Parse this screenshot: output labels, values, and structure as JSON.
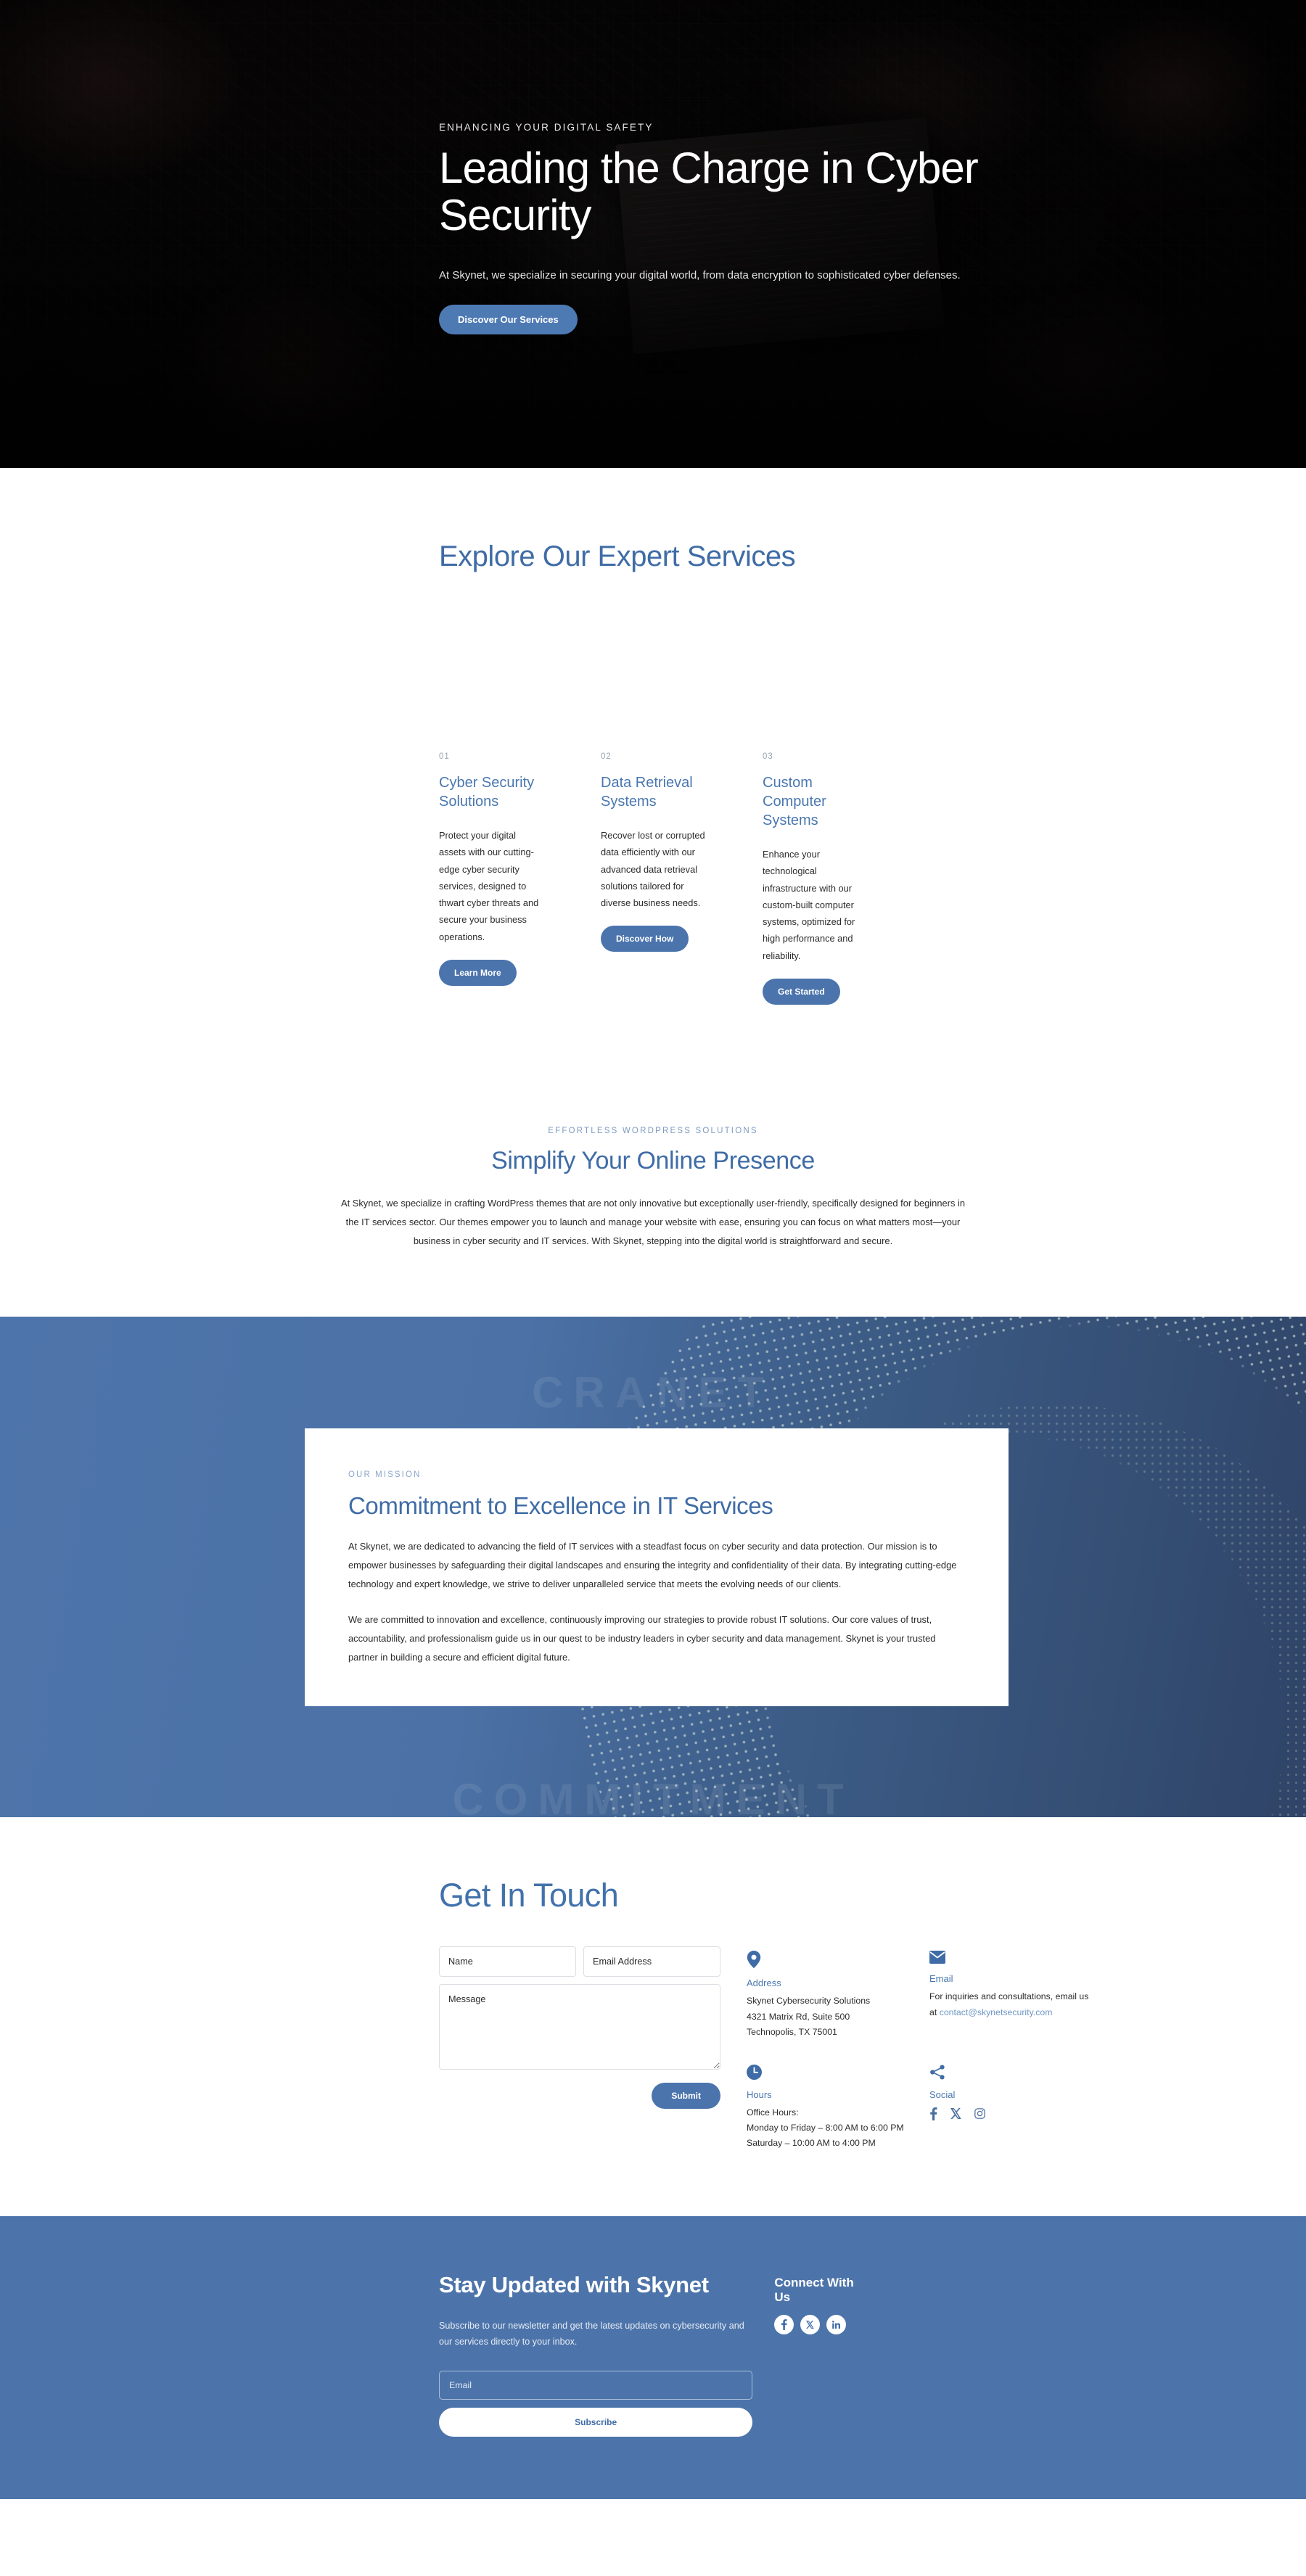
{
  "hero": {
    "eyebrow": "ENHANCING YOUR DIGITAL SAFETY",
    "title": "Leading the Charge in Cyber Security",
    "subtitle": "At Skynet, we specialize in securing your digital world, from data encryption to sophisticated cyber defenses.",
    "cta": "Discover Our Services"
  },
  "services": {
    "title": "Explore Our Expert Services",
    "cards": [
      {
        "num": "01",
        "title": "Cyber Security Solutions",
        "text": "Protect your digital assets with our cutting-edge cyber security services, designed to thwart cyber threats and secure your business operations.",
        "cta": "Learn More"
      },
      {
        "num": "02",
        "title": "Data Retrieval Systems",
        "text": "Recover lost or corrupted data efficiently with our advanced data retrieval solutions tailored for diverse business needs.",
        "cta": "Discover How"
      },
      {
        "num": "03",
        "title": "Custom Computer Systems",
        "text": "Enhance your technological infrastructure with our custom-built computer systems, optimized for high performance and reliability.",
        "cta": "Get Started"
      }
    ]
  },
  "simplify": {
    "eyebrow": "EFFORTLESS WORDPRESS SOLUTIONS",
    "title": "Simplify Your Online Presence",
    "text": "At Skynet, we specialize in crafting WordPress themes that are not only innovative but exceptionally user-friendly, specifically designed for beginners in the IT services sector. Our themes empower you to launch and manage your website with ease, ensuring you can focus on what matters most—your business in cyber security and IT services. With Skynet, stepping into the digital world is straightforward and secure."
  },
  "mission": {
    "watermark_top": "CRANET",
    "watermark_bottom": "COMMITMENT",
    "eyebrow": "OUR MISSION",
    "title": "Commitment to Excellence in IT Services",
    "paragraph1": "At Skynet, we are dedicated to advancing the field of IT services with a steadfast focus on cyber security and data protection. Our mission is to empower businesses by safeguarding their digital landscapes and ensuring the integrity and confidentiality of their data. By integrating cutting-edge technology and expert knowledge, we strive to deliver unparalleled service that meets the evolving needs of our clients.",
    "paragraph2": "We are committed to innovation and excellence, continuously improving our strategies to provide robust IT solutions. Our core values of trust, accountability, and professionalism guide us in our quest to be industry leaders in cyber security and data management. Skynet is your trusted partner in building a secure and efficient digital future."
  },
  "contact": {
    "title": "Get In Touch",
    "form": {
      "name_placeholder": "Name",
      "email_placeholder": "Email Address",
      "message_placeholder": "Message",
      "submit_label": "Submit"
    },
    "info": [
      {
        "icon": "location-pin-icon",
        "label": "Address",
        "text": "Skynet Cybersecurity Solutions\n4321 Matrix Rd, Suite 500\nTechnopolis, TX 75001"
      },
      {
        "icon": "envelope-icon",
        "label": "Email",
        "text": "For inquiries and consultations, email us at ",
        "link": "contact@skynetsecurity.com"
      },
      {
        "icon": "clock-icon",
        "label": "Hours",
        "text": "Office Hours:\nMonday to Friday – 8:00 AM to 6:00 PM\nSaturday – 10:00 AM to 4:00 PM"
      },
      {
        "icon": "share-icon",
        "label": "Social",
        "socials": [
          "facebook-icon",
          "x-twitter-icon",
          "instagram-icon"
        ]
      }
    ]
  },
  "footer": {
    "title": "Stay Updated with Skynet",
    "text": "Subscribe to our newsletter and get the latest updates on cybersecurity and our services directly to your inbox.",
    "email_placeholder": "Email",
    "subscribe_label": "Subscribe",
    "connect_title": "Connect With Us",
    "socials": [
      {
        "icon": "facebook-icon",
        "glyph": "f"
      },
      {
        "icon": "x-twitter-icon",
        "glyph": "𝕏"
      },
      {
        "icon": "linkedin-icon",
        "glyph": "in"
      }
    ]
  },
  "colors": {
    "accent": "#4b74ad",
    "heading": "#3f6ca6",
    "footer_bg": "#4d74aa",
    "muted": "#9aa3ad"
  }
}
